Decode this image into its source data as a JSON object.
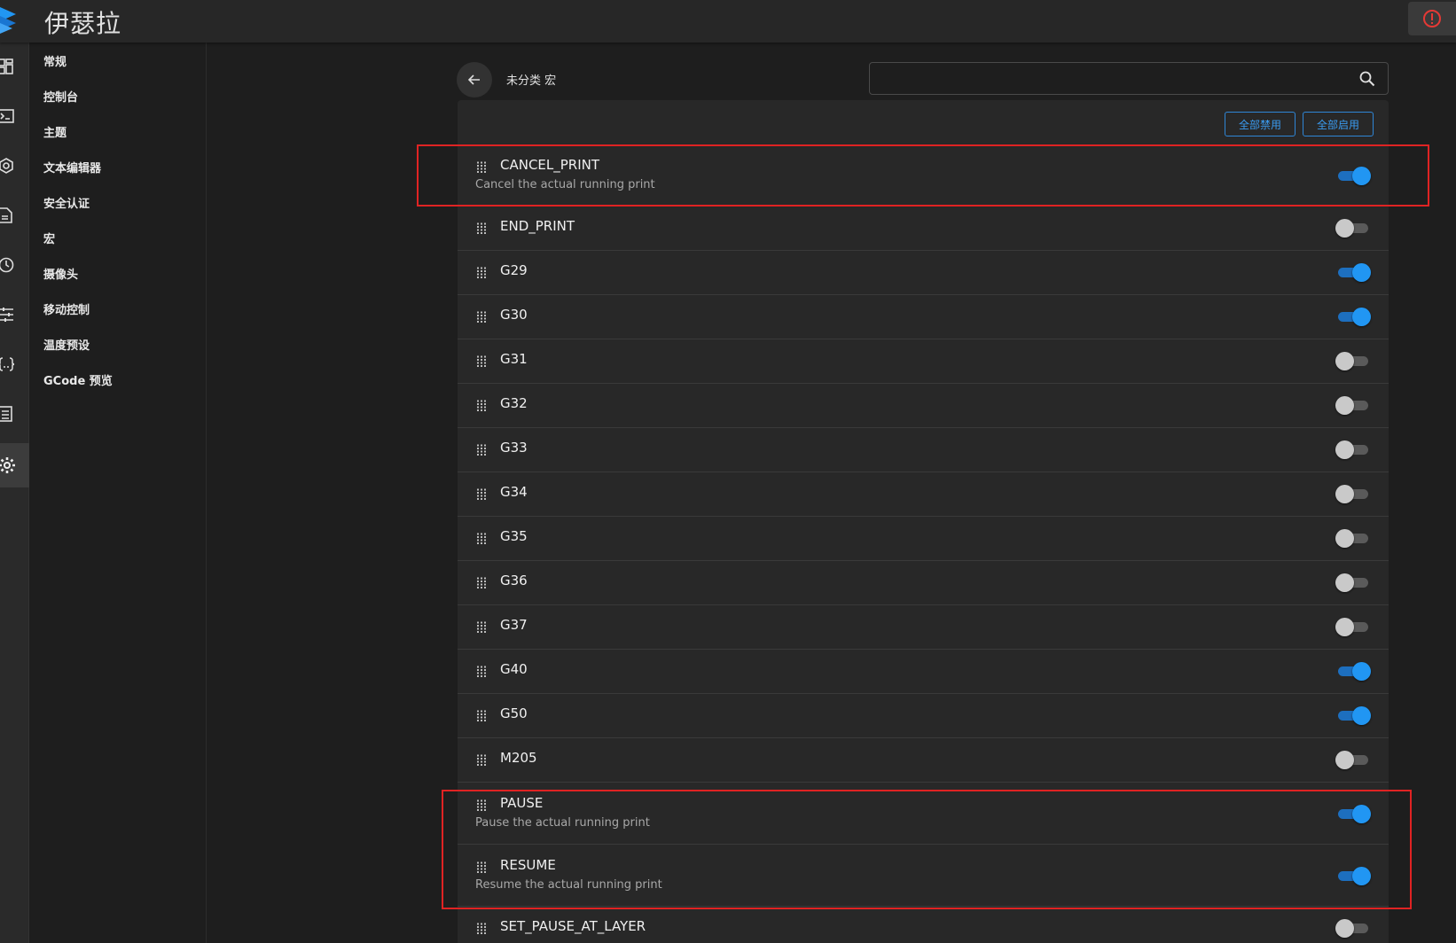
{
  "app": {
    "title": "伊瑟拉"
  },
  "topbar": {
    "emergency_icon": "power-alert-icon",
    "accent": "#e53935"
  },
  "rail": {
    "icons": [
      "dashboard-icon",
      "console-icon",
      "heightmap-icon",
      "files-icon",
      "history-icon",
      "tune-icon",
      "macros-code-icon",
      "machine-icon",
      "settings-gear-icon"
    ],
    "active_index": 8
  },
  "subnav": {
    "items": [
      "常规",
      "控制台",
      "主题",
      "文本编辑器",
      "安全认证",
      "宏",
      "摄像头",
      "移动控制",
      "温度预设",
      "GCode 预览"
    ]
  },
  "group": {
    "title": "未分类 宏"
  },
  "search": {
    "value": "",
    "placeholder": ""
  },
  "toolbar": {
    "disable_all": "全部禁用",
    "enable_all": "全部启用",
    "accent": "#2196f3"
  },
  "macros": [
    {
      "name": "CANCEL_PRINT",
      "desc": "Cancel the actual running print",
      "enabled": true
    },
    {
      "name": "END_PRINT",
      "desc": "",
      "enabled": false
    },
    {
      "name": "G29",
      "desc": "",
      "enabled": true
    },
    {
      "name": "G30",
      "desc": "",
      "enabled": true
    },
    {
      "name": "G31",
      "desc": "",
      "enabled": false
    },
    {
      "name": "G32",
      "desc": "",
      "enabled": false
    },
    {
      "name": "G33",
      "desc": "",
      "enabled": false
    },
    {
      "name": "G34",
      "desc": "",
      "enabled": false
    },
    {
      "name": "G35",
      "desc": "",
      "enabled": false
    },
    {
      "name": "G36",
      "desc": "",
      "enabled": false
    },
    {
      "name": "G37",
      "desc": "",
      "enabled": false
    },
    {
      "name": "G40",
      "desc": "",
      "enabled": true
    },
    {
      "name": "G50",
      "desc": "",
      "enabled": true
    },
    {
      "name": "M205",
      "desc": "",
      "enabled": false
    },
    {
      "name": "PAUSE",
      "desc": "Pause the actual running print",
      "enabled": true
    },
    {
      "name": "RESUME",
      "desc": "Resume the actual running print",
      "enabled": true
    },
    {
      "name": "SET_PAUSE_AT_LAYER",
      "desc": "",
      "enabled": false
    }
  ]
}
